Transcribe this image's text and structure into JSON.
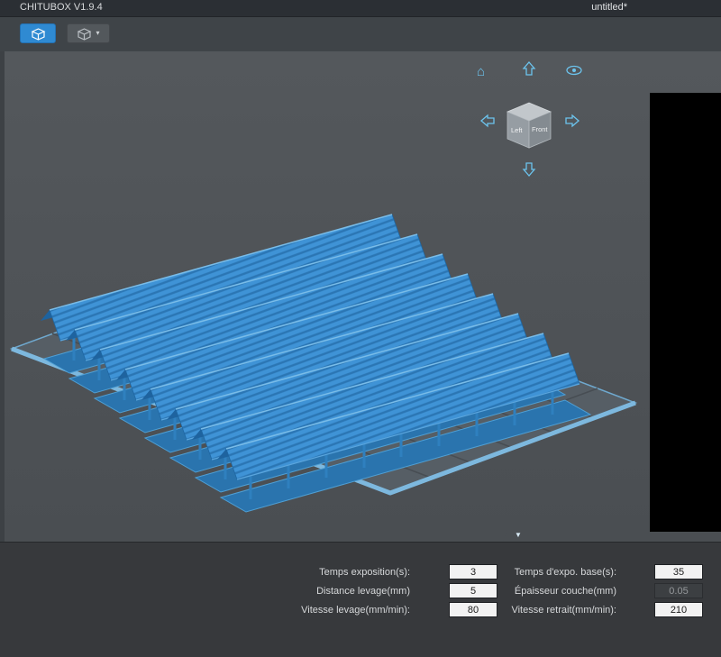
{
  "window": {
    "app_title": "CHITUBOX V1.9.4",
    "document_title": "untitled*"
  },
  "toolbar": {
    "slice_button_icon": "printer-box-icon",
    "slice_alt_button_icon": "printer-box-icon",
    "dropdown_caret": "▾"
  },
  "viewport": {
    "view_cube": {
      "left_face": "Left",
      "front_face": "Front"
    },
    "nav": {
      "home_icon": "⌂"
    },
    "collapse_caret": "▼"
  },
  "settings_panel": {
    "rows": [
      {
        "left": {
          "label": "Temps exposition(s):",
          "value": "3"
        },
        "right": {
          "label": "Temps d'expo. base(s):",
          "value": "35"
        }
      },
      {
        "left": {
          "label": "Distance levage(mm)",
          "value": "5"
        },
        "right": {
          "label": "Épaisseur couche(mm)",
          "value": "0.05",
          "disabled": true
        }
      },
      {
        "left": {
          "label": "Vitesse levage(mm/min):",
          "value": "80"
        },
        "right": {
          "label": "Vitesse retrait(mm/min):",
          "value": "210"
        }
      }
    ]
  },
  "colors": {
    "accent_blue": "#2f8ad2",
    "model_blue": "#3f93d6",
    "plate_rim": "#7db8de",
    "nav_arrow": "#6cc4ee"
  }
}
